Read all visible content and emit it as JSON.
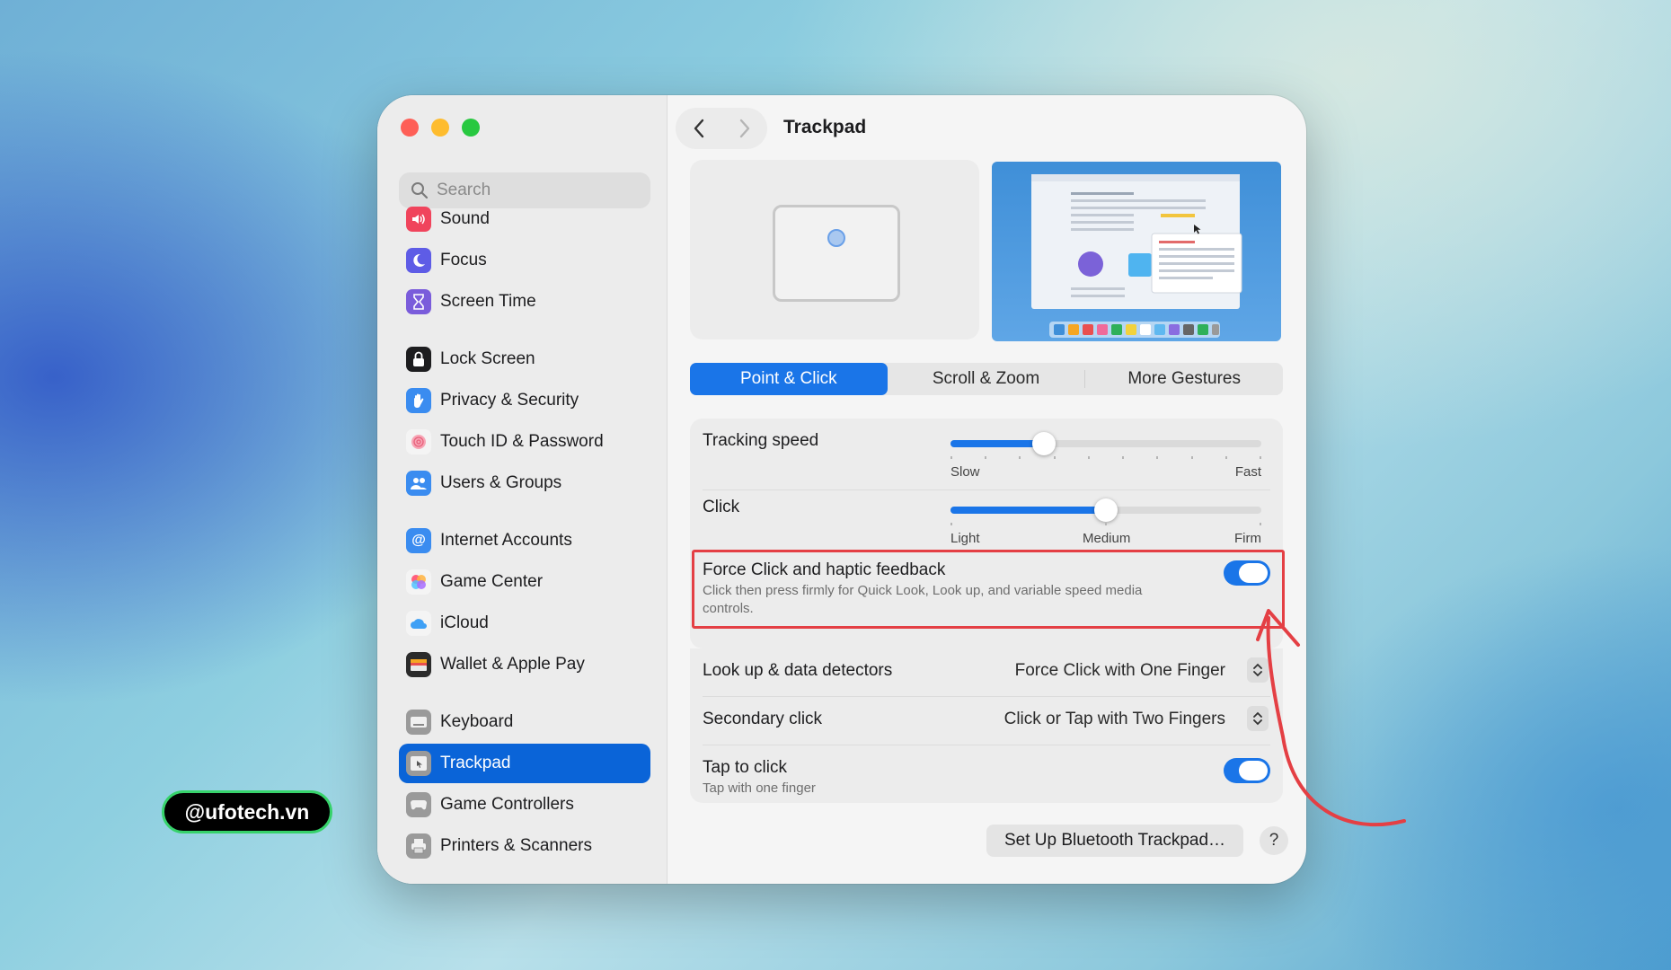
{
  "window": {
    "title": "Trackpad"
  },
  "search": {
    "placeholder": "Search"
  },
  "sidebar": {
    "items": [
      {
        "label": "Sound",
        "icon": "speaker-icon",
        "color": "#f0445c"
      },
      {
        "label": "Focus",
        "icon": "moon-icon",
        "color": "#5e5ce6"
      },
      {
        "label": "Screen Time",
        "icon": "hourglass-icon",
        "color": "#7a5cdb"
      },
      {
        "label": "Lock Screen",
        "icon": "lock-icon",
        "color": "#1d1d1f"
      },
      {
        "label": "Privacy & Security",
        "icon": "hand-icon",
        "color": "#3a8cf0"
      },
      {
        "label": "Touch ID & Password",
        "icon": "fingerprint-icon",
        "color": "#f4f4f4"
      },
      {
        "label": "Users & Groups",
        "icon": "users-icon",
        "color": "#3a8cf0"
      },
      {
        "label": "Internet Accounts",
        "icon": "at-icon",
        "color": "#3a8cf0"
      },
      {
        "label": "Game Center",
        "icon": "game-center-icon",
        "color": "#f4f4f4"
      },
      {
        "label": "iCloud",
        "icon": "cloud-icon",
        "color": "#f4f4f4"
      },
      {
        "label": "Wallet & Apple Pay",
        "icon": "wallet-icon",
        "color": "#2b2b2b"
      },
      {
        "label": "Keyboard",
        "icon": "keyboard-icon",
        "color": "#9a9a9a"
      },
      {
        "label": "Trackpad",
        "icon": "trackpad-icon",
        "color": "#9a9a9a",
        "selected": true
      },
      {
        "label": "Game Controllers",
        "icon": "gamepad-icon",
        "color": "#9a9a9a"
      },
      {
        "label": "Printers & Scanners",
        "icon": "printer-icon",
        "color": "#9a9a9a"
      }
    ]
  },
  "tabs": [
    "Point & Click",
    "Scroll & Zoom",
    "More Gestures"
  ],
  "active_tab": "Point & Click",
  "tracking": {
    "label": "Tracking speed",
    "min_label": "Slow",
    "max_label": "Fast",
    "value_fraction": 0.3
  },
  "click": {
    "label": "Click",
    "min_label": "Light",
    "mid_label": "Medium",
    "max_label": "Firm",
    "value_fraction": 0.5
  },
  "force_click": {
    "label": "Force Click and haptic feedback",
    "description": "Click then press firmly for Quick Look, Look up, and variable speed media controls.",
    "enabled": true
  },
  "lookup": {
    "label": "Look up & data detectors",
    "value": "Force Click with One Finger"
  },
  "secondary_click": {
    "label": "Secondary click",
    "value": "Click or Tap with Two Fingers"
  },
  "tap_to_click": {
    "label": "Tap to click",
    "description": "Tap with one finger",
    "enabled": true
  },
  "buttons": {
    "bluetooth": "Set Up Bluetooth Trackpad…",
    "help": "?"
  },
  "watermark": "@ufotech.vn",
  "colors": {
    "accent": "#1a75e8",
    "highlight": "#e43f44"
  }
}
